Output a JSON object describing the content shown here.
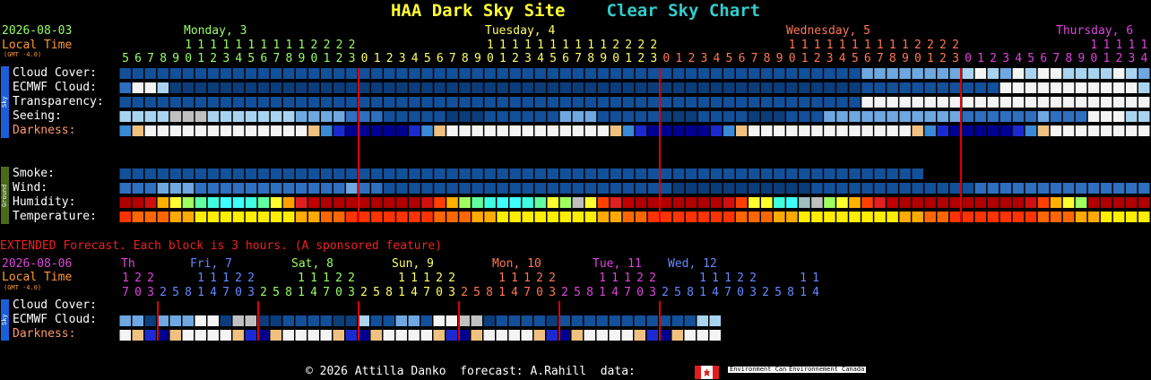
{
  "header": {
    "site": "HAA Dark Sky Site",
    "chart": "Clear Sky Chart"
  },
  "top": {
    "date": "2026-08-03",
    "local_time": "Local Time",
    "gmt": "(GMT -4.0)",
    "days": [
      {
        "label": "Monday, 3",
        "color": "#99ff66"
      },
      {
        "label": "Tuesday, 4",
        "color": "#ffff66"
      },
      {
        "label": "Wednesday, 5",
        "color": "#ff7755"
      },
      {
        "label": "Thursday, 6",
        "color": "#dd44dd"
      }
    ],
    "hours": [
      5,
      6,
      7,
      8,
      9,
      10,
      11,
      12,
      13,
      14,
      15,
      16,
      17,
      18,
      19,
      20,
      21,
      22,
      23,
      0,
      1,
      2,
      3,
      4,
      5,
      6,
      7,
      8,
      9,
      10,
      11,
      12,
      13,
      14,
      15,
      16,
      17,
      18,
      19,
      20,
      21,
      22,
      23,
      0,
      1,
      2,
      3,
      4,
      5,
      6,
      7,
      8,
      9,
      10,
      11,
      12,
      13,
      14,
      15,
      16,
      17,
      18,
      19,
      20,
      21,
      22,
      23,
      0,
      1,
      2,
      3,
      4,
      5,
      6,
      7,
      8,
      9,
      10,
      11,
      12,
      13,
      14,
      15,
      16,
      17,
      18,
      19,
      20,
      21,
      22,
      23,
      0,
      1,
      2,
      3,
      4
    ],
    "sky_label": "Sky",
    "ground_label": "Ground",
    "rows": [
      {
        "label": "Cloud Cover:",
        "color": "#ffffff"
      },
      {
        "label": "ECMWF Cloud:",
        "color": "#ffffff"
      },
      {
        "label": "Transparency:",
        "color": "#ffffff"
      },
      {
        "label": "Seeing:",
        "color": "#ffffff"
      },
      {
        "label": "Darkness:",
        "color": "#ff9966"
      },
      {
        "label": "Smoke:",
        "color": "#ffffff"
      },
      {
        "label": "Wind:",
        "color": "#ffffff"
      },
      {
        "label": "Humidity:",
        "color": "#ffffff"
      },
      {
        "label": "Temperature:",
        "color": "#ffffff"
      }
    ]
  },
  "extended": {
    "banner": "EXTENDED Forecast. Each block is 3 hours. (A sponsored feature)",
    "date": "2026-08-06",
    "local_time": "Local Time",
    "gmt": "(GMT -4.0)",
    "days": [
      {
        "label": "Th",
        "color": "#dd44dd"
      },
      {
        "label": "Fri, 7",
        "color": "#6688ff"
      },
      {
        "label": "Sat, 8",
        "color": "#99ff66"
      },
      {
        "label": "Sun, 9",
        "color": "#ffff66"
      },
      {
        "label": "Mon, 10",
        "color": "#ff7755"
      },
      {
        "label": "Tue, 11",
        "color": "#dd44dd"
      },
      {
        "label": "Wed, 12",
        "color": "#6688ff"
      }
    ],
    "hours": [
      17,
      20,
      23,
      2,
      5,
      8,
      11,
      14,
      17,
      20,
      23,
      2,
      5,
      8,
      11,
      14,
      17,
      20,
      23,
      2,
      5,
      8,
      11,
      14,
      17,
      20,
      23,
      2,
      5,
      8,
      11,
      14,
      17,
      20,
      23,
      2,
      5,
      8,
      11,
      14,
      17,
      20,
      23,
      2,
      5,
      8,
      11,
      14,
      17,
      20,
      23,
      2,
      5,
      8,
      11,
      14
    ],
    "rows": [
      {
        "label": "Cloud Cover:",
        "color": "#ffffff"
      },
      {
        "label": "ECMWF Cloud:",
        "color": "#ffffff"
      },
      {
        "label": "Darkness:",
        "color": "#ff9966"
      }
    ]
  },
  "footer": {
    "text": "© 2026 Attilla Danko  forecast: A.Rahill  data:",
    "agency1": "Environment\nCanada",
    "agency2": "Environnement\nCanada"
  }
}
